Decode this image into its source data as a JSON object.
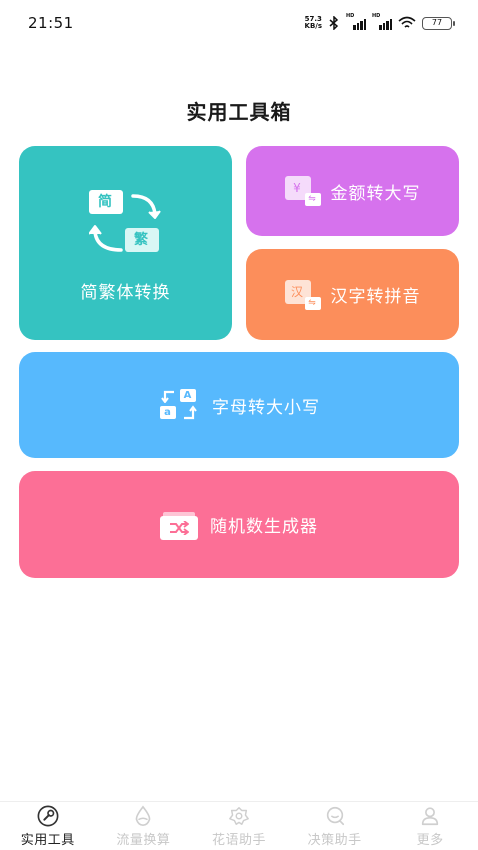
{
  "status_bar": {
    "time": "21:51",
    "net_speed_value": "57.3",
    "net_speed_unit": "KB/s",
    "signal_1_label": "HD",
    "signal_2_label": "HD",
    "battery": "77"
  },
  "page": {
    "title": "实用工具箱"
  },
  "tools": {
    "traditional": {
      "label": "简繁体转换",
      "simplified_char": "简",
      "traditional_char": "繁",
      "color": "#35c3c1"
    },
    "money": {
      "label": "金额转大写",
      "icon_char": "¥",
      "color": "#d672ed"
    },
    "pinyin": {
      "label": "汉字转拼音",
      "icon_char": "汉",
      "color": "#fc8e5b"
    },
    "letter_case": {
      "label": "字母转大小写",
      "icon_upper": "A",
      "icon_lower": "a",
      "color": "#57b9fd"
    },
    "random": {
      "label": "随机数生成器",
      "color": "#fc6f96"
    }
  },
  "tab_bar": {
    "tabs": [
      {
        "label": "实用工具",
        "icon": "wrench-icon",
        "active": true
      },
      {
        "label": "流量换算",
        "icon": "droplet-icon",
        "active": false
      },
      {
        "label": "花语助手",
        "icon": "flower-icon",
        "active": false
      },
      {
        "label": "决策助手",
        "icon": "search-chat-icon",
        "active": false
      },
      {
        "label": "更多",
        "icon": "user-icon",
        "active": false
      }
    ]
  }
}
